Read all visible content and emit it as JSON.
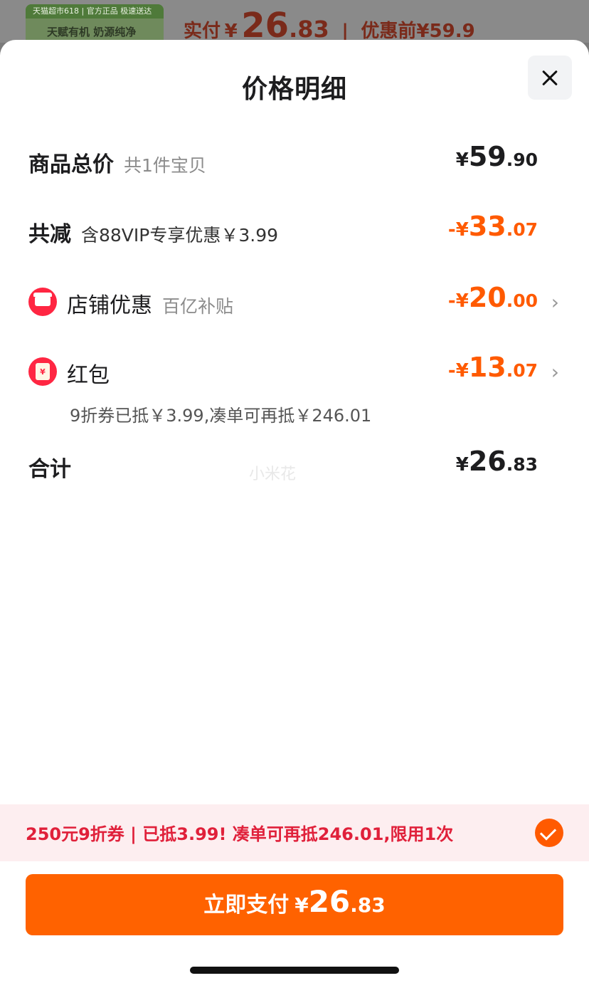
{
  "background": {
    "thumb_top": "天猫超市618 | 官方正品 极速送达",
    "thumb_text": "天赋有机 奶源纯净",
    "paid_label": "实付",
    "paid_symbol": "¥",
    "paid_int": "26",
    "paid_dec": ".83",
    "original_label": "优惠前",
    "original_price": "¥59.9"
  },
  "sheet": {
    "title": "价格明细"
  },
  "rows": {
    "total": {
      "label": "商品总价",
      "sub": "共1件宝贝",
      "symbol": "¥",
      "int": "59",
      "dec": ".90"
    },
    "reduce": {
      "label": "共减",
      "sub": "含88VIP专享优惠￥3.99",
      "symbol": "-¥",
      "int": "33",
      "dec": ".07"
    },
    "shop": {
      "label": "店铺优惠",
      "sub": "百亿补贴",
      "symbol": "-¥",
      "int": "20",
      "dec": ".00",
      "icon": "store-icon"
    },
    "redpack": {
      "label": "红包",
      "symbol": "-¥",
      "int": "13",
      "dec": ".07",
      "icon": "red-envelope-icon",
      "icon_glyph": "¥",
      "note": "9折券已抵￥3.99,凑单可再抵￥246.01"
    },
    "sum": {
      "label": "合计",
      "symbol": "¥",
      "int": "26",
      "dec": ".83"
    }
  },
  "watermark": "小米花",
  "coupon": {
    "text": "250元9折券 | 已抵3.99! 凑单可再抵246.01,限用1次",
    "checked": true
  },
  "pay_button": {
    "label": "立即支付",
    "symbol": "¥",
    "int": "26",
    "dec": ".83"
  },
  "colors": {
    "accent": "#ff6200",
    "discount": "#ff5a00",
    "coupon_text": "#e0203a",
    "coupon_bg": "#fdeef0"
  }
}
